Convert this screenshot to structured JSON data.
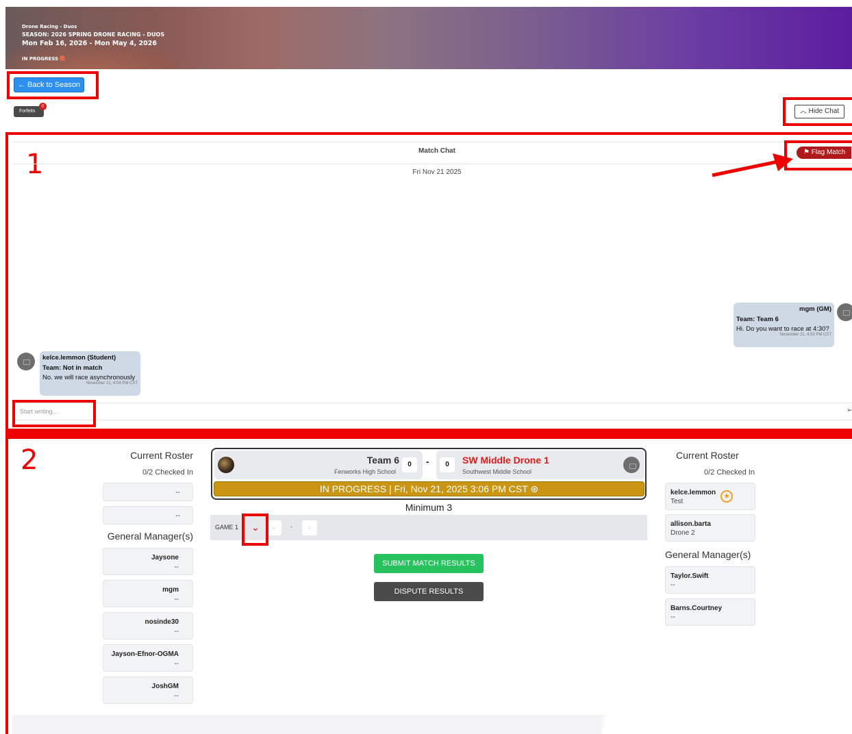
{
  "banner": {
    "category": "Drone Racing - Duos",
    "season": "SEASON: 2026 SPRING DRONE RACING - DUOS",
    "dates": "Mon Feb 16, 2026  -  Mon May 4, 2026",
    "status": "IN PROGRESS"
  },
  "toolbar": {
    "back_label": "Back to Season",
    "forfeits_label": "Forfeits",
    "forfeits_count": "0",
    "hide_chat_label": "Hide Chat"
  },
  "annotations": {
    "label_1": "1",
    "label_2": "2",
    "color": "#ee0000"
  },
  "chat": {
    "title": "Match Chat",
    "date": "Fri Nov 21 2025",
    "flag_label": "Flag Match",
    "placeholder": "Start writing...",
    "messages": [
      {
        "name": "mgm (GM)",
        "team": "Team: Team 6",
        "text": "Hi. Do you want to race at 4:30?",
        "time": "November 21, 4:03 PM CST"
      },
      {
        "name": "kelce.lemmon (Student)",
        "team": "Team: Not in match",
        "text": "No. we will race asynchronously",
        "time": "November 21, 4:04 PM CST"
      }
    ]
  },
  "left_roster": {
    "heading": "Current Roster",
    "checked": "0/2 Checked In",
    "players": [
      "--",
      "--"
    ],
    "gm_heading": "General Manager(s)",
    "gms": [
      {
        "name": "Jaysone",
        "sub": "--"
      },
      {
        "name": "mgm",
        "sub": "--"
      },
      {
        "name": "nosinde30",
        "sub": "--"
      },
      {
        "name": "Jayson-Efnor-OGMA",
        "sub": "--"
      },
      {
        "name": "JoshGM",
        "sub": "--"
      }
    ]
  },
  "match": {
    "team_left": {
      "name": "Team 6",
      "school": "Fenworks High School",
      "score": "0"
    },
    "team_right": {
      "name": "SW Middle Drone 1",
      "school": "Southwest Middle School",
      "score": "0"
    },
    "separator": "-",
    "status": "IN PROGRESS | Fri, Nov 21, 2025 3:06 PM CST",
    "minimum": "Minimum 3",
    "game_label": "GAME 1",
    "game_left": "-",
    "game_sep": "-",
    "game_right": "-",
    "submit_label": "SUBMIT MATCH RESULTS",
    "dispute_label": "DISPUTE RESULTS"
  },
  "right_roster": {
    "heading": "Current Roster",
    "checked": "0/2 Checked In",
    "players": [
      {
        "name": "kelce.lemmon",
        "sub": "Test"
      },
      {
        "name": "allison.barta",
        "sub": "Drone 2"
      }
    ],
    "gm_heading": "General Manager(s)",
    "gms": [
      {
        "name": "Taylor.Swift",
        "sub": "--"
      },
      {
        "name": "Barns.Courtney",
        "sub": "--"
      }
    ]
  },
  "colors": {
    "accent_blue": "#2d8ff0",
    "flag_red": "#b0191b",
    "status_gold": "#c99512",
    "submit_green": "#27c15d",
    "team_red": "#e01b1b"
  }
}
